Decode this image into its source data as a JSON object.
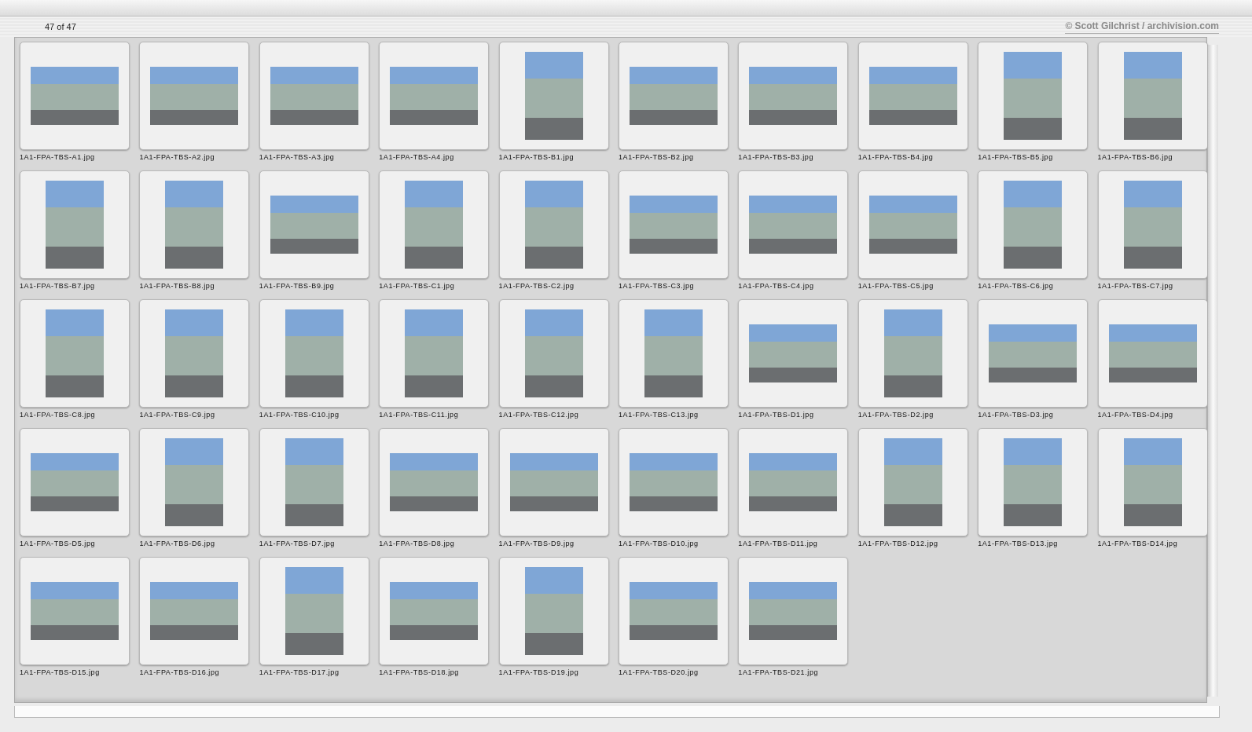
{
  "header": {
    "count": "47 of 47",
    "credit": "© Scott Gilchrist / archivision.com"
  },
  "thumbnails": [
    {
      "filename": "1A1-FPA-TBS-A1.jpg",
      "kind": "landscape"
    },
    {
      "filename": "1A1-FPA-TBS-A2.jpg",
      "kind": "landscape"
    },
    {
      "filename": "1A1-FPA-TBS-A3.jpg",
      "kind": "landscape"
    },
    {
      "filename": "1A1-FPA-TBS-A4.jpg",
      "kind": "landscape"
    },
    {
      "filename": "1A1-FPA-TBS-B1.jpg",
      "kind": "portrait"
    },
    {
      "filename": "1A1-FPA-TBS-B2.jpg",
      "kind": "landscape"
    },
    {
      "filename": "1A1-FPA-TBS-B3.jpg",
      "kind": "landscape"
    },
    {
      "filename": "1A1-FPA-TBS-B4.jpg",
      "kind": "landscape"
    },
    {
      "filename": "1A1-FPA-TBS-B5.jpg",
      "kind": "portrait"
    },
    {
      "filename": "1A1-FPA-TBS-B6.jpg",
      "kind": "portrait"
    },
    {
      "filename": "1A1-FPA-TBS-B7.jpg",
      "kind": "portrait"
    },
    {
      "filename": "1A1-FPA-TBS-B8.jpg",
      "kind": "portrait"
    },
    {
      "filename": "1A1-FPA-TBS-B9.jpg",
      "kind": "landscape"
    },
    {
      "filename": "1A1-FPA-TBS-C1.jpg",
      "kind": "portrait"
    },
    {
      "filename": "1A1-FPA-TBS-C2.jpg",
      "kind": "portrait"
    },
    {
      "filename": "1A1-FPA-TBS-C3.jpg",
      "kind": "landscape"
    },
    {
      "filename": "1A1-FPA-TBS-C4.jpg",
      "kind": "landscape"
    },
    {
      "filename": "1A1-FPA-TBS-C5.jpg",
      "kind": "landscape"
    },
    {
      "filename": "1A1-FPA-TBS-C6.jpg",
      "kind": "portrait"
    },
    {
      "filename": "1A1-FPA-TBS-C7.jpg",
      "kind": "portrait"
    },
    {
      "filename": "1A1-FPA-TBS-C8.jpg",
      "kind": "portrait"
    },
    {
      "filename": "1A1-FPA-TBS-C9.jpg",
      "kind": "portrait"
    },
    {
      "filename": "1A1-FPA-TBS-C10.jpg",
      "kind": "portrait"
    },
    {
      "filename": "1A1-FPA-TBS-C11.jpg",
      "kind": "portrait"
    },
    {
      "filename": "1A1-FPA-TBS-C12.jpg",
      "kind": "portrait"
    },
    {
      "filename": "1A1-FPA-TBS-C13.jpg",
      "kind": "portrait"
    },
    {
      "filename": "1A1-FPA-TBS-D1.jpg",
      "kind": "landscape"
    },
    {
      "filename": "1A1-FPA-TBS-D2.jpg",
      "kind": "portrait"
    },
    {
      "filename": "1A1-FPA-TBS-D3.jpg",
      "kind": "landscape"
    },
    {
      "filename": "1A1-FPA-TBS-D4.jpg",
      "kind": "landscape"
    },
    {
      "filename": "1A1-FPA-TBS-D5.jpg",
      "kind": "landscape"
    },
    {
      "filename": "1A1-FPA-TBS-D6.jpg",
      "kind": "portrait"
    },
    {
      "filename": "1A1-FPA-TBS-D7.jpg",
      "kind": "portrait"
    },
    {
      "filename": "1A1-FPA-TBS-D8.jpg",
      "kind": "landscape"
    },
    {
      "filename": "1A1-FPA-TBS-D9.jpg",
      "kind": "landscape"
    },
    {
      "filename": "1A1-FPA-TBS-D10.jpg",
      "kind": "landscape"
    },
    {
      "filename": "1A1-FPA-TBS-D11.jpg",
      "kind": "landscape"
    },
    {
      "filename": "1A1-FPA-TBS-D12.jpg",
      "kind": "portrait"
    },
    {
      "filename": "1A1-FPA-TBS-D13.jpg",
      "kind": "portrait"
    },
    {
      "filename": "1A1-FPA-TBS-D14.jpg",
      "kind": "portrait"
    },
    {
      "filename": "1A1-FPA-TBS-D15.jpg",
      "kind": "landscape"
    },
    {
      "filename": "1A1-FPA-TBS-D16.jpg",
      "kind": "landscape"
    },
    {
      "filename": "1A1-FPA-TBS-D17.jpg",
      "kind": "portrait"
    },
    {
      "filename": "1A1-FPA-TBS-D18.jpg",
      "kind": "landscape"
    },
    {
      "filename": "1A1-FPA-TBS-D19.jpg",
      "kind": "portrait"
    },
    {
      "filename": "1A1-FPA-TBS-D20.jpg",
      "kind": "landscape"
    },
    {
      "filename": "1A1-FPA-TBS-D21.jpg",
      "kind": "landscape"
    }
  ]
}
